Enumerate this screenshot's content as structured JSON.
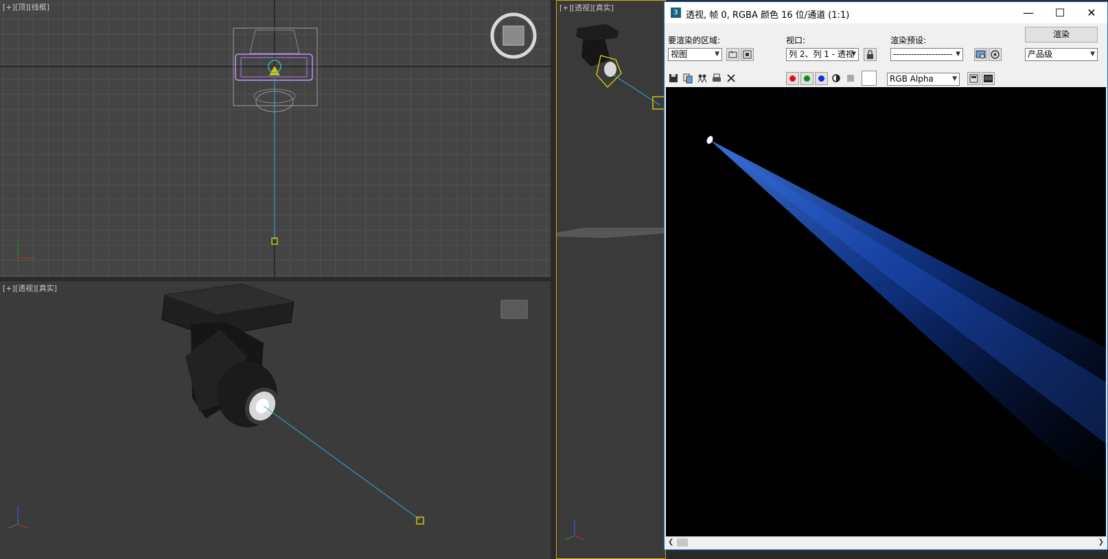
{
  "viewports": {
    "top": {
      "plus": "[+]",
      "view": "[顶]",
      "shading": "[线框]"
    },
    "perspective": {
      "plus": "[+]",
      "view": "[透视]",
      "shading": "[真实]"
    },
    "right": {
      "plus": "[+]",
      "view": "[透视]",
      "shading": "[真实]"
    }
  },
  "render_window": {
    "title": "透视, 帧 0, RGBA 颜色 16 位/通道 (1:1)",
    "area_label": "要渲染的区域:",
    "area_value": "视图",
    "viewport_label": "视口:",
    "viewport_value": "列 2、列 1 - 透视",
    "preset_label": "渲染预设:",
    "preset_value": "--------------------",
    "render_button": "渲染",
    "quality_value": "产品级",
    "channel_value": "RGB Alpha"
  },
  "colors": {
    "viewport_bg": "#444444",
    "selection": "#c8b400",
    "beam": "#1e62ff",
    "target_line": "#3aa8e0"
  },
  "icons": [
    "save-icon",
    "copy-icon",
    "clone-icon",
    "print-icon",
    "clear-icon",
    "red-channel-icon",
    "green-channel-icon",
    "blue-channel-icon",
    "mono-icon",
    "alpha-icon",
    "lock-icon",
    "render-setup-icon",
    "environment-icon",
    "display-icon",
    "fullscreen-icon"
  ]
}
